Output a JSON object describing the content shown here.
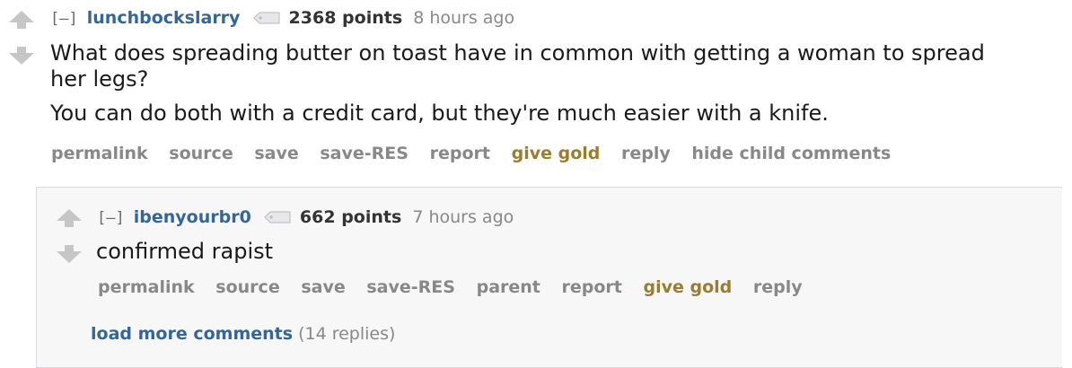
{
  "parent": {
    "expand": "[–]",
    "author": "lunchbockslarry",
    "score": "2368 points",
    "time": "8 hours ago",
    "body": [
      "What does spreading butter on toast have in common with getting a woman to spread her legs?",
      "You can do both with a credit card, but they're much easier with a knife."
    ],
    "buttons": {
      "permalink": "permalink",
      "source": "source",
      "save": "save",
      "save_res": "save-RES",
      "report": "report",
      "give_gold": "give gold",
      "reply": "reply",
      "hide_child": "hide child comments"
    }
  },
  "child": {
    "expand": "[–]",
    "author": "ibenyourbr0",
    "score": "662 points",
    "time": "7 hours ago",
    "body": "confirmed rapist",
    "buttons": {
      "permalink": "permalink",
      "source": "source",
      "save": "save",
      "save_res": "save-RES",
      "parent": "parent",
      "report": "report",
      "give_gold": "give gold",
      "reply": "reply"
    },
    "load_more": {
      "label": "load more comments",
      "count": "(14 replies)"
    }
  },
  "colors": {
    "author": "#336699",
    "gold": "#9a7d2e",
    "meta": "#888888"
  }
}
